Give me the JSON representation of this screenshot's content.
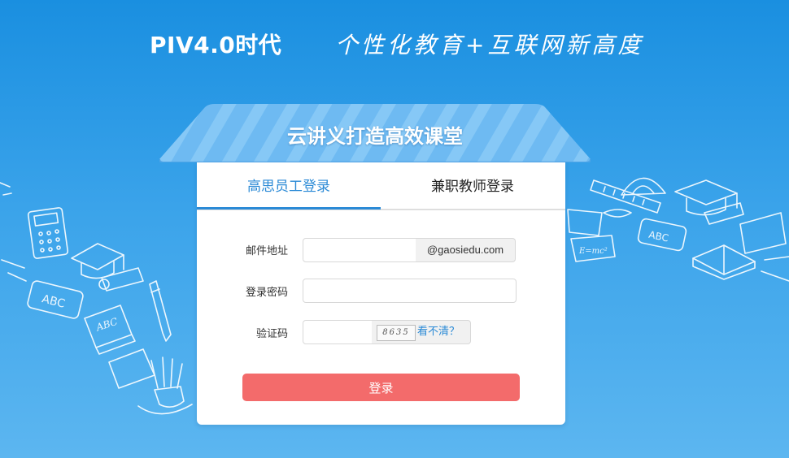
{
  "header": {
    "brand": "PIV4.0时代",
    "slogan": "个性化教育+互联网新高度"
  },
  "panel": {
    "title": "云讲义打造高效课堂"
  },
  "tabs": [
    {
      "label": "高思员工登录",
      "active": true
    },
    {
      "label": "兼职教师登录",
      "active": false
    }
  ],
  "form": {
    "email_label": "邮件地址",
    "email_value": "",
    "email_suffix": "@gaosiedu.com",
    "password_label": "登录密码",
    "password_value": "",
    "captcha_label": "验证码",
    "captcha_value": "",
    "captcha_image_text": "8635",
    "captcha_refresh": "看不清？",
    "submit_label": "登录"
  },
  "colors": {
    "accent": "#2b8ad6",
    "button": "#f36b6b",
    "background": "#1a8fe0"
  },
  "icons": [
    "calculator-icon",
    "graduation-cap-icon",
    "abc-eraser-icon",
    "abc-book-icon",
    "pen-icon",
    "pencil-cup-icon",
    "ruler-icon",
    "protractor-icon",
    "diploma-icon",
    "open-book-icon"
  ]
}
